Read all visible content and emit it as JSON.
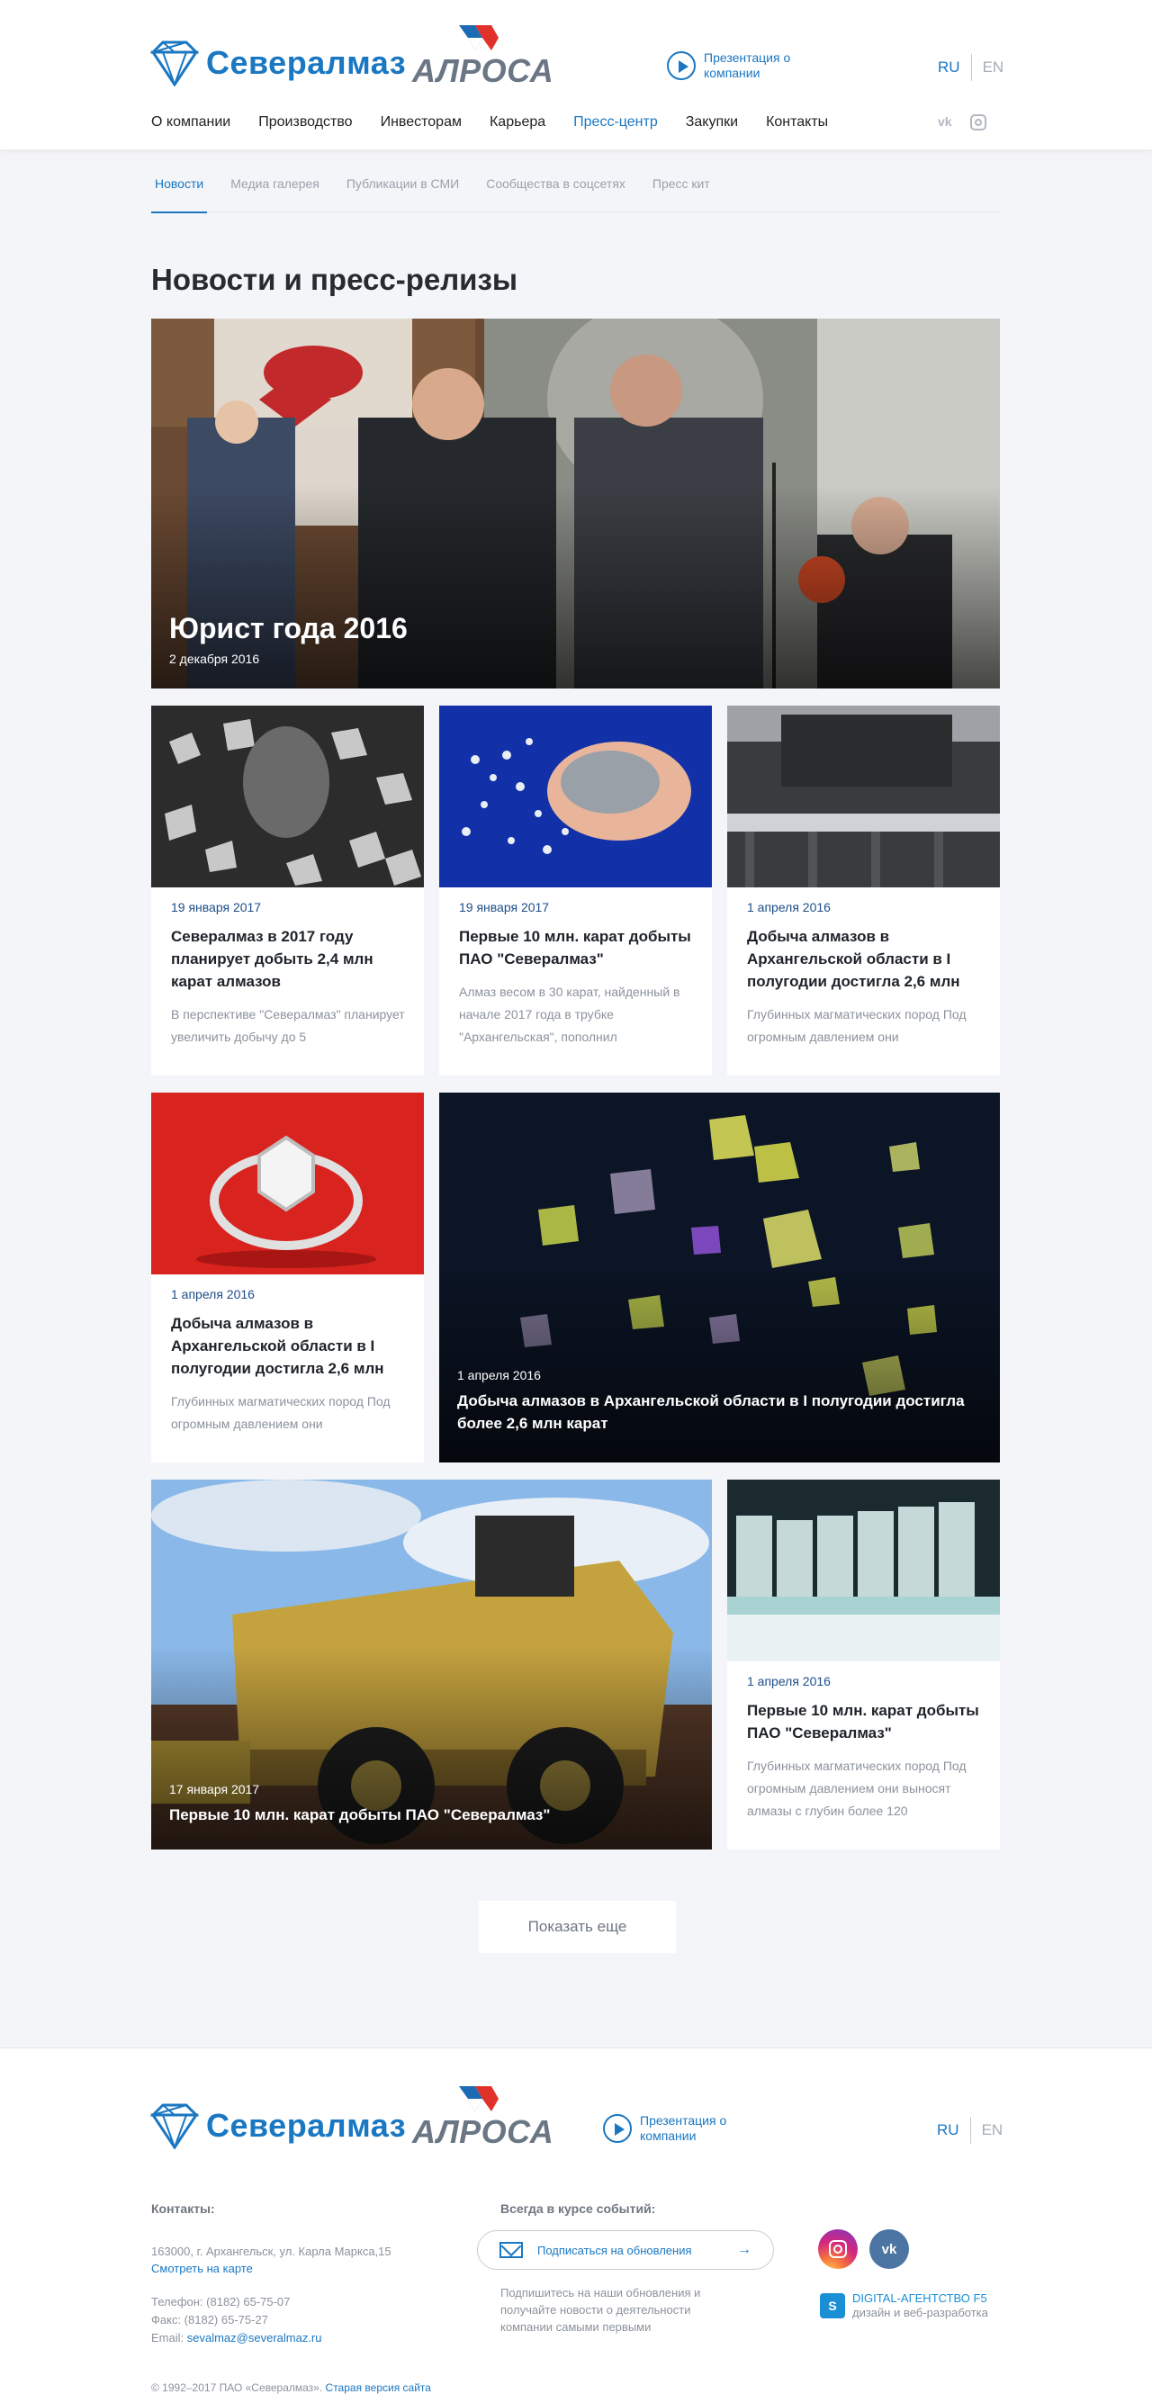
{
  "header": {
    "brand": "Севералмаз",
    "partner_brand": "АЛРОСА",
    "presentation": "Презентация о компании",
    "lang_ru": "RU",
    "lang_en": "EN",
    "nav": [
      "О компании",
      "Производство",
      "Инвесторам",
      "Карьера",
      "Пресс-центр",
      "Закупки",
      "Контакты"
    ],
    "nav_active": "Пресс-центр",
    "social": [
      "vk-icon",
      "instagram-icon"
    ]
  },
  "subnav": {
    "items": [
      "Новости",
      "Медиа галерея",
      "Публикации в СМИ",
      "Сообщества в соцсетях",
      "Пресс кит"
    ],
    "active": "Новости"
  },
  "page_title": "Новости и пресс-релизы",
  "featured": {
    "title": "Юрист года 2016",
    "date": "2 декабря 2016"
  },
  "cards": [
    {
      "date": "19 января 2017",
      "title": "Севералмаз в 2017 году планирует добыть 2,4 млн карат алмазов",
      "excerpt": "В перспективе \"Севералмаз\" планирует увеличить добычу до 5"
    },
    {
      "date": "19 января 2017",
      "title": "Первые 10 млн. карат добыты ПАО \"Севералмаз\"",
      "excerpt": "Алмаз весом в 30 карат, найденный в начале 2017 года в трубке \"Архангельская\", пополнил"
    },
    {
      "date": "1 апреля 2016",
      "title": "Добыча алмазов в Архангельской области в I полугодии достигла 2,6 млн",
      "excerpt": "Глубинных магматических пород Под огромным давлением они"
    },
    {
      "date": "1 апреля 2016",
      "title": "Добыча алмазов в Архангельской области в I полугодии достигла 2,6 млн",
      "excerpt": "Глубинных магматических пород Под огромным давлением они"
    },
    {
      "date": "1 апреля 2016",
      "title": "Добыча алмазов в Архангельской области в I полугодии достигла более 2,6 млн карат"
    },
    {
      "date": "17 января 2017",
      "title": "Первые 10 млн. карат добыты ПАО \"Севералмаз\""
    },
    {
      "date": "1 апреля 2016",
      "title": "Первые 10 млн. карат добыты ПАО \"Севералмаз\"",
      "excerpt": "Глубинных магматических пород Под огромным давлением они выносят алмазы с глубин более 120"
    }
  ],
  "more_button": "Показать еще",
  "footer": {
    "contacts_title": "Контакты:",
    "address": "163000, г. Архангельск, ул. Карла Маркса,15",
    "map_link": "Смотреть на карте",
    "phone": "Телефон: (8182) 65-75-07",
    "fax": "Факс: (8182) 65-75-27",
    "email_label": "Email:",
    "email": "sevalmaz@severalmaz.ru",
    "subscribe_title": "Всегда в курсе событий:",
    "subscribe_button": "Подписаться на обновления",
    "subscribe_note": "Подпишитесь на наши обновления и получайте новости о деятельности компании самыми первыми",
    "agency_name": "DIGITAL-АГЕНТСТВО F5",
    "agency_desc": "дизайн и веб-разработка",
    "copyright": "© 1992–2017 ПАО «Севералмаз».",
    "old_site": "Старая версия сайта"
  },
  "colors": {
    "accent": "#1a77c2",
    "date": "#1d4e89",
    "background": "#f4f5f8"
  }
}
